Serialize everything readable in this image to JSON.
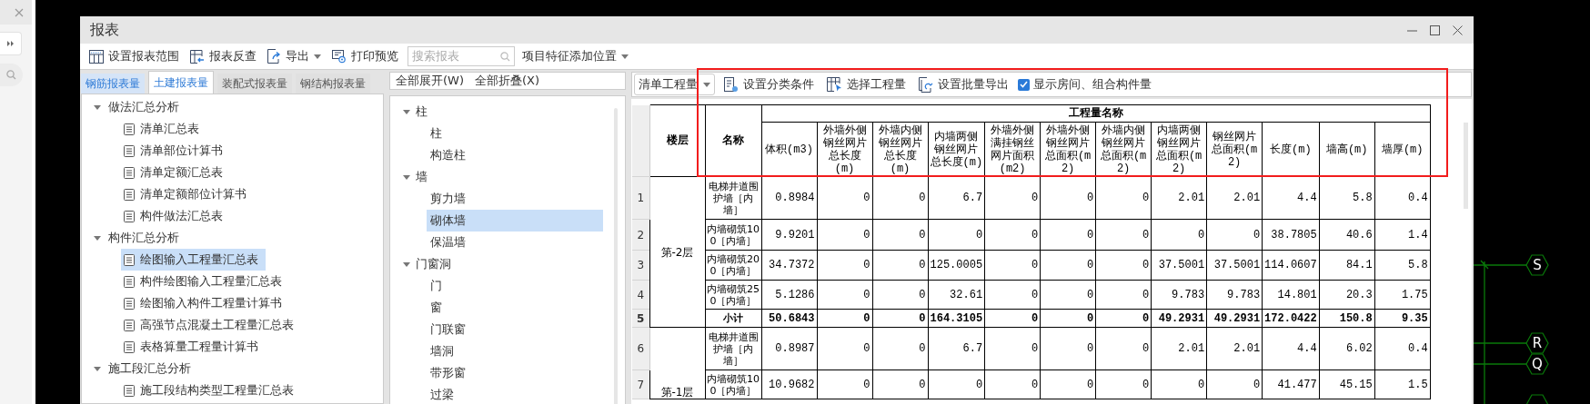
{
  "window": {
    "title": "报表"
  },
  "toolbar": [
    {
      "kind": "button",
      "label": "设置报表范围"
    },
    {
      "kind": "button",
      "label": "报表反查"
    },
    {
      "kind": "menu",
      "label": "导出"
    },
    {
      "kind": "button",
      "label": "打印预览"
    },
    {
      "kind": "search",
      "placeholder": "搜索报表"
    },
    {
      "kind": "menu",
      "label": "项目特征添加位置"
    }
  ],
  "report_tabs": [
    {
      "label": "钢筋报表量",
      "selected": false,
      "hover": true
    },
    {
      "label": "土建报表量",
      "selected": true,
      "hover": false
    },
    {
      "label": "装配式报表量",
      "selected": false,
      "hover": false
    },
    {
      "label": "钢结构报表量",
      "selected": false,
      "hover": false
    }
  ],
  "report_tree": [
    {
      "label": "做法汇总分析",
      "expanded": true,
      "children": [
        {
          "label": "清单汇总表",
          "selected": false
        },
        {
          "label": "清单部位计算书",
          "selected": false
        },
        {
          "label": "清单定额汇总表",
          "selected": false
        },
        {
          "label": "清单定额部位计算书",
          "selected": false
        },
        {
          "label": "构件做法汇总表",
          "selected": false
        }
      ]
    },
    {
      "label": "构件汇总分析",
      "expanded": true,
      "children": [
        {
          "label": "绘图输入工程量汇总表",
          "selected": true
        },
        {
          "label": "构件绘图输入工程量汇总表",
          "selected": false
        },
        {
          "label": "绘图输入构件工程量计算书",
          "selected": false
        },
        {
          "label": "高强节点混凝土工程量汇总表",
          "selected": false
        },
        {
          "label": "表格算量工程量计算书",
          "selected": false
        }
      ]
    },
    {
      "label": "施工段汇总分析",
      "expanded": true,
      "children": [
        {
          "label": "施工段结构类型工程量汇总表",
          "selected": false
        }
      ]
    }
  ],
  "expand_buttons": [
    "全部展开(W)",
    "全部折叠(X)"
  ],
  "component_tree": [
    {
      "label": "柱",
      "expanded": true,
      "children": [
        {
          "label": "柱",
          "selected": false
        },
        {
          "label": "构造柱",
          "selected": false
        }
      ]
    },
    {
      "label": "墙",
      "expanded": true,
      "children": [
        {
          "label": "剪力墙",
          "selected": false
        },
        {
          "label": "砌体墙",
          "selected": true
        },
        {
          "label": "保温墙",
          "selected": false
        }
      ]
    },
    {
      "label": "门窗洞",
      "expanded": true,
      "children": [
        {
          "label": "门",
          "selected": false
        },
        {
          "label": "窗",
          "selected": false
        },
        {
          "label": "门联窗",
          "selected": false
        },
        {
          "label": "墙洞",
          "selected": false
        },
        {
          "label": "带形窗",
          "selected": false
        },
        {
          "label": "过梁",
          "selected": false
        }
      ]
    }
  ],
  "quantity_toolbar": {
    "dropdown": "清单工程量",
    "buttons": [
      "设置分类条件",
      "选择工程量",
      "设置批量导出"
    ],
    "checkbox": {
      "label": "显示房间、组合构件量",
      "checked": true
    }
  },
  "table": {
    "columns": [
      "楼层",
      "名称"
    ],
    "group_header": "工程量名称",
    "quantity_columns": [
      "体积(m3)",
      "外墙外侧钢丝网片总长度(m)",
      "外墙内侧钢丝网片总长度(m)",
      "内墙两侧钢丝网片总长度(m)",
      "外墙外侧满挂钢丝网片面积(m2)",
      "外墙外侧钢丝网片总面积(m2)",
      "外墙内侧钢丝网片总面积(m2)",
      "内墙两侧钢丝网片总面积(m2)",
      "钢丝网片总面积(m2)",
      "长度(m)",
      "墙高(m)",
      "墙厚(m)"
    ],
    "floors": [
      {
        "label": "第-2层",
        "rows": [
          {
            "kind": "item",
            "number": "1",
            "name": "电梯井道围护墙［内墙］",
            "values": [
              "0.8984",
              "0",
              "0",
              "6.7",
              "0",
              "0",
              "0",
              "2.01",
              "2.01",
              "4.4",
              "5.8",
              "0.4"
            ]
          },
          {
            "kind": "item",
            "number": "2",
            "name": "内墙砌筑100［内墙］",
            "values": [
              "9.9201",
              "0",
              "0",
              "0",
              "0",
              "0",
              "0",
              "0",
              "0",
              "38.7805",
              "40.6",
              "1.4"
            ]
          },
          {
            "kind": "item",
            "number": "3",
            "name": "内墙砌筑200［内墙］",
            "values": [
              "34.7372",
              "0",
              "0",
              "125.0005",
              "0",
              "0",
              "0",
              "37.5001",
              "37.5001",
              "114.0607",
              "84.1",
              "5.8"
            ]
          },
          {
            "kind": "item",
            "number": "4",
            "name": "内墙砌筑250［内墙］",
            "values": [
              "5.1286",
              "0",
              "0",
              "32.61",
              "0",
              "0",
              "0",
              "9.783",
              "9.783",
              "14.801",
              "20.3",
              "1.75"
            ]
          },
          {
            "kind": "subtotal",
            "number": "5",
            "name": "小计",
            "values": [
              "50.6843",
              "0",
              "0",
              "164.3105",
              "0",
              "0",
              "0",
              "49.2931",
              "49.2931",
              "172.0422",
              "150.8",
              "9.35"
            ]
          }
        ]
      },
      {
        "label": "第-1层",
        "rows": [
          {
            "kind": "item",
            "number": "6",
            "name": "电梯井道围护墙［内墙］",
            "values": [
              "0.8987",
              "0",
              "0",
              "6.7",
              "0",
              "0",
              "0",
              "2.01",
              "2.01",
              "4.4",
              "6.02",
              "0.4"
            ]
          },
          {
            "kind": "item",
            "number": "7",
            "name": "内墙砌筑100［内墙］",
            "values": [
              "10.9682",
              "0",
              "0",
              "0",
              "0",
              "0",
              "0",
              "0",
              "0",
              "41.477",
              "45.15",
              "1.5"
            ]
          }
        ]
      }
    ]
  },
  "drawing": {
    "axis_labels": [
      "S",
      "R",
      "Q"
    ]
  }
}
